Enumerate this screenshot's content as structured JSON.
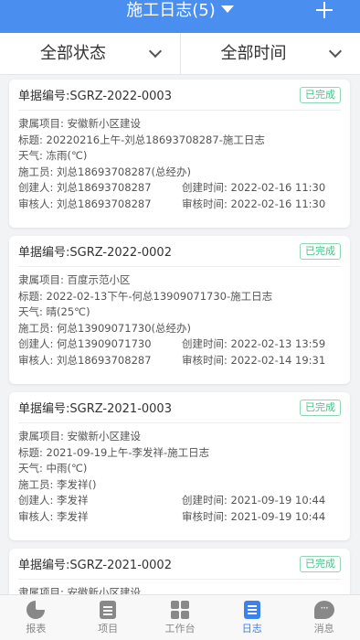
{
  "header": {
    "title": "施工日志(5)"
  },
  "filters": {
    "status": "全部状态",
    "time": "全部时间"
  },
  "cards": [
    {
      "no": "单据编号:SGRZ-2022-0003",
      "status": "已完成",
      "project": "隶属项目: 安徽新小区建设",
      "title": "标题: 20220216上午-刘总18693708287-施工日志",
      "weather": "天气: 冻雨(℃)",
      "worker": "施工员: 刘总18693708287(总经办)",
      "creator": "创建人: 刘总18693708287",
      "created": "创建时间: 2022-02-16 11:30",
      "reviewer": "审核人: 刘总18693708287",
      "reviewed": "审核时间: 2022-02-16 11:30"
    },
    {
      "no": "单据编号:SGRZ-2022-0002",
      "status": "已完成",
      "project": "隶属项目: 百度示范小区",
      "title": "标题: 2022-02-13下午-何总13909071730-施工日志",
      "weather": "天气: 晴(25℃)",
      "worker": "施工员: 何总13909071730(总经办)",
      "creator": "创建人: 何总13909071730",
      "created": "创建时间: 2022-02-13 13:59",
      "reviewer": "审核人: 刘总18693708287",
      "reviewed": "审核时间: 2022-02-14 19:31"
    },
    {
      "no": "单据编号:SGRZ-2021-0003",
      "status": "已完成",
      "project": "隶属项目: 安徽新小区建设",
      "title": "标题: 2021-09-19上午-李发祥-施工日志",
      "weather": "天气: 中雨(℃)",
      "worker": "施工员: 李发祥()",
      "creator": "创建人: 李发祥",
      "created": "创建时间: 2021-09-19 10:44",
      "reviewer": "审核人: 李发祥",
      "reviewed": "审核时间: 2021-09-19 10:44"
    },
    {
      "no": "单据编号:SGRZ-2021-0002",
      "status": "已完成",
      "project": "隶属项目: 安徽新小区建设"
    }
  ],
  "tabbar": {
    "tabs": [
      {
        "label": "报表",
        "icon": "pie-chart-icon"
      },
      {
        "label": "项目",
        "icon": "document-icon"
      },
      {
        "label": "工作台",
        "icon": "grid-icon"
      },
      {
        "label": "日志",
        "icon": "log-icon"
      },
      {
        "label": "消息",
        "icon": "message-icon"
      }
    ],
    "active": "日志"
  },
  "colors": {
    "header": "#4a8ef0",
    "accent": "#3b82f0",
    "badge": "#4cc08a"
  }
}
